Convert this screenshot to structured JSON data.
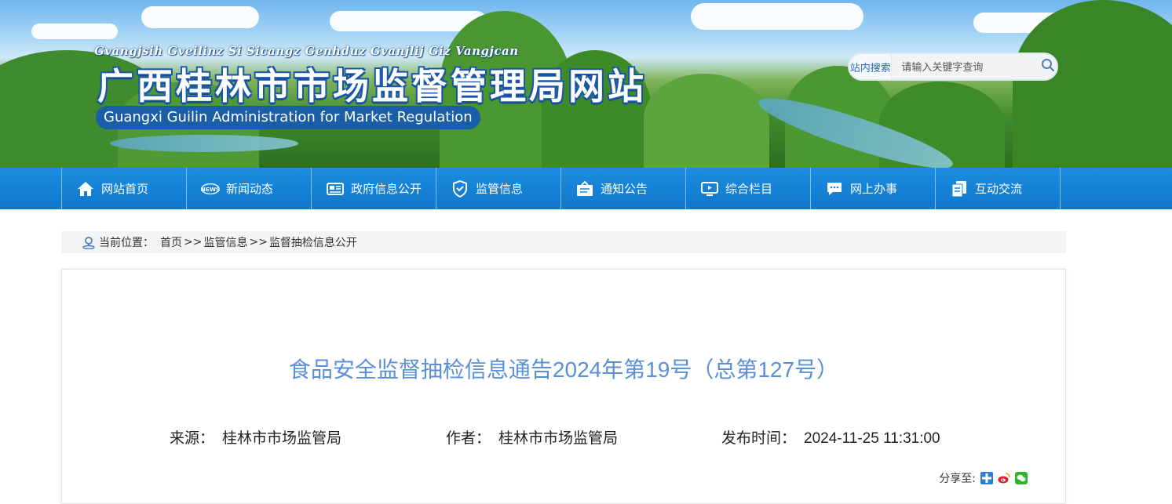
{
  "header": {
    "pinyin": "Gvangjsih Gveilinz Si Sicangz Genhduz Gvanjlij Giz Vangjcan",
    "title": "广西桂林市市场监督管理局网站",
    "english": "Guangxi Guilin Administration for Market Regulation"
  },
  "search": {
    "label": "站内搜索",
    "placeholder": "请输入关键字查询",
    "button_icon": "search-icon"
  },
  "nav": {
    "items": [
      {
        "label": "网站首页",
        "icon": "home-icon"
      },
      {
        "label": "新闻动态",
        "icon": "news-icon"
      },
      {
        "label": "政府信息公开",
        "icon": "newspaper-icon"
      },
      {
        "label": "监管信息",
        "icon": "shield-icon"
      },
      {
        "label": "通知公告",
        "icon": "notice-board-icon"
      },
      {
        "label": "综合栏目",
        "icon": "monitor-icon"
      },
      {
        "label": "网上办事",
        "icon": "chat-icon"
      },
      {
        "label": "互动交流",
        "icon": "documents-icon"
      }
    ]
  },
  "breadcrumb": {
    "prefix": "当前位置：",
    "items": [
      "首页",
      "监管信息",
      "监督抽检信息公开"
    ],
    "separator": ">>"
  },
  "article": {
    "title": "食品安全监督抽检信息通告2024年第19号（总第127号）",
    "source_label": "来源：",
    "source": "桂林市市场监管局",
    "author_label": "作者：",
    "author": "桂林市市场监管局",
    "date_label": "发布时间：",
    "date": "2024-11-25 11:31:00",
    "share_label": "分享至:",
    "share_icons": [
      "qzone-icon",
      "weibo-icon",
      "wechat-icon"
    ]
  },
  "colors": {
    "nav_bg": "#0f77cc",
    "title_blue": "#5a8fd6",
    "brand_dark_blue": "#1b5ea8"
  }
}
